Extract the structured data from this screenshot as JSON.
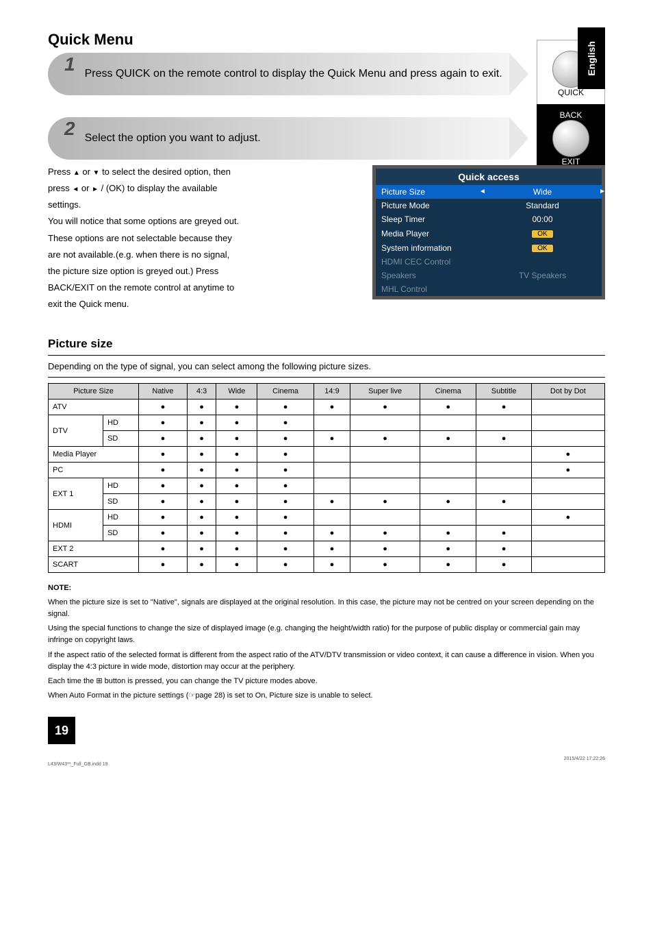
{
  "sideTab": "English",
  "pageTitle": "Quick Menu",
  "step1": {
    "number": "1",
    "text": "Press QUICK on the remote control to display the Quick Menu and press again to exit.",
    "iconLabelBottom": "QUICK"
  },
  "step2": {
    "number": "2",
    "text": "Select the option you want to adjust.",
    "iconLabelTop": "BACK",
    "iconLabelBottom": "EXIT"
  },
  "instructions": {
    "line1_pre": "Press ",
    "line1_mid": " or ",
    "line1_post": " to select the desired option, then",
    "line2_pre": "press ",
    "line2_mid": " or ",
    "line2_post": " / (OK) to display the available",
    "line3": "settings.",
    "line4": "You will notice that some options are greyed out.",
    "line5": "These options are not selectable because they",
    "line6": "are not available.(e.g. when there is no signal,",
    "line7": "the picture size option is greyed out.) Press",
    "line8": "BACK/EXIT on the remote control at anytime to",
    "line9": "exit the Quick menu."
  },
  "menuPanel": {
    "title": "Quick access",
    "rows": [
      {
        "label": "Picture Size",
        "value": "Wide",
        "selected": true,
        "chevrons": true
      },
      {
        "label": "Picture Mode",
        "value": "Standard"
      },
      {
        "label": "Sleep Timer",
        "value": "00:00"
      },
      {
        "label": "Media Player",
        "value": "OK",
        "ok": true
      },
      {
        "label": "System information",
        "value": "OK",
        "ok": true
      },
      {
        "label": "HDMI CEC Control",
        "value": "",
        "dim": true
      },
      {
        "label": "Speakers",
        "value": "TV Speakers",
        "dim": true
      },
      {
        "label": "MHL Control",
        "value": "",
        "dim": true
      }
    ]
  },
  "pictureSize": {
    "heading": "Picture size",
    "intro": "Depending on the type of signal, you can select among the following picture sizes.",
    "headers": {
      "pictureSize": "Picture\nSize",
      "native": "Native",
      "p43": "4:3",
      "wide": "Wide",
      "cinema": "Cinema",
      "14_9": "14:9",
      "super_live": "Super\nlive",
      "cinema2": "Cinema",
      "subtitle": "Subtitle",
      "dbd": "Dot by\nDot"
    },
    "rows": [
      {
        "cells": [
          {
            "text": "ATV",
            "span": 2
          },
          "●",
          "●",
          "●",
          "●",
          "●",
          "●",
          "●",
          "●",
          ""
        ]
      },
      {
        "cells": [
          {
            "text": "DTV",
            "rowspan": 2,
            "sub": "HD"
          },
          "●",
          "●",
          "●",
          "●",
          "",
          "",
          "",
          "",
          ""
        ]
      },
      {
        "cells": [
          {
            "sub": "SD"
          },
          "●",
          "●",
          "●",
          "●",
          "●",
          "●",
          "●",
          "●",
          ""
        ]
      },
      {
        "cells": [
          {
            "text": "Media Player",
            "span": 2
          },
          "●",
          "●",
          "●",
          "●",
          "",
          "",
          "",
          "",
          "●"
        ]
      },
      {
        "cells": [
          {
            "text": "PC",
            "span": 2
          },
          "●",
          "●",
          "●",
          "●",
          "",
          "",
          "",
          "",
          "●"
        ]
      },
      {
        "cells": [
          {
            "text": "EXT 1",
            "rowspan": 2,
            "sub": "HD"
          },
          "●",
          "●",
          "●",
          "●",
          "",
          "",
          "",
          "",
          ""
        ]
      },
      {
        "cells": [
          {
            "sub": "SD"
          },
          "●",
          "●",
          "●",
          "●",
          "●",
          "●",
          "●",
          "●",
          ""
        ]
      },
      {
        "cells": [
          {
            "text": "HDMI",
            "rowspan": 2,
            "sub": "HD"
          },
          "●",
          "●",
          "●",
          "●",
          "",
          "",
          "",
          "",
          "●"
        ]
      },
      {
        "cells": [
          {
            "sub": "SD"
          },
          "●",
          "●",
          "●",
          "●",
          "●",
          "●",
          "●",
          "●",
          ""
        ]
      },
      {
        "cells": [
          {
            "text": "EXT 2",
            "span": 2
          },
          "●",
          "●",
          "●",
          "●",
          "●",
          "●",
          "●",
          "●",
          ""
        ]
      },
      {
        "cells": [
          {
            "text": "SCART",
            "span": 2
          },
          "●",
          "●",
          "●",
          "●",
          "●",
          "●",
          "●",
          "●",
          ""
        ]
      }
    ]
  },
  "notes": {
    "title": "NOTE:",
    "n1": "When the picture size is set to \"Native\", signals are displayed at the original resolution. In this case, the picture may not be centred on your screen depending on the signal.",
    "n2": "Using the special functions to change the size of displayed image (e.g. changing the height/width ratio) for the purpose of public display or commercial gain may infringe on copyright laws.",
    "n3": "If the aspect ratio of the selected format is different from the aspect ratio of the ATV/DTV transmission or video context, it can cause a difference in vision. When you display the 4:3 picture in wide mode, distortion may occur at the periphery.",
    "n4_pre": "Each time the ",
    "n4_btn": "⊞",
    "n4_post": " button is pressed, you can change the TV picture modes above.",
    "n5_pre": "When Auto Format in the picture settings (",
    "n5_icon": "☞",
    "n5_page": "page 28",
    "n5_post": ") is set to On, Picture size is unable to select."
  },
  "footer": {
    "page": "19",
    "tag": "L43/W43**_Full_GB.indd   19",
    "stamp": "2015/4/22   17:22:26"
  }
}
